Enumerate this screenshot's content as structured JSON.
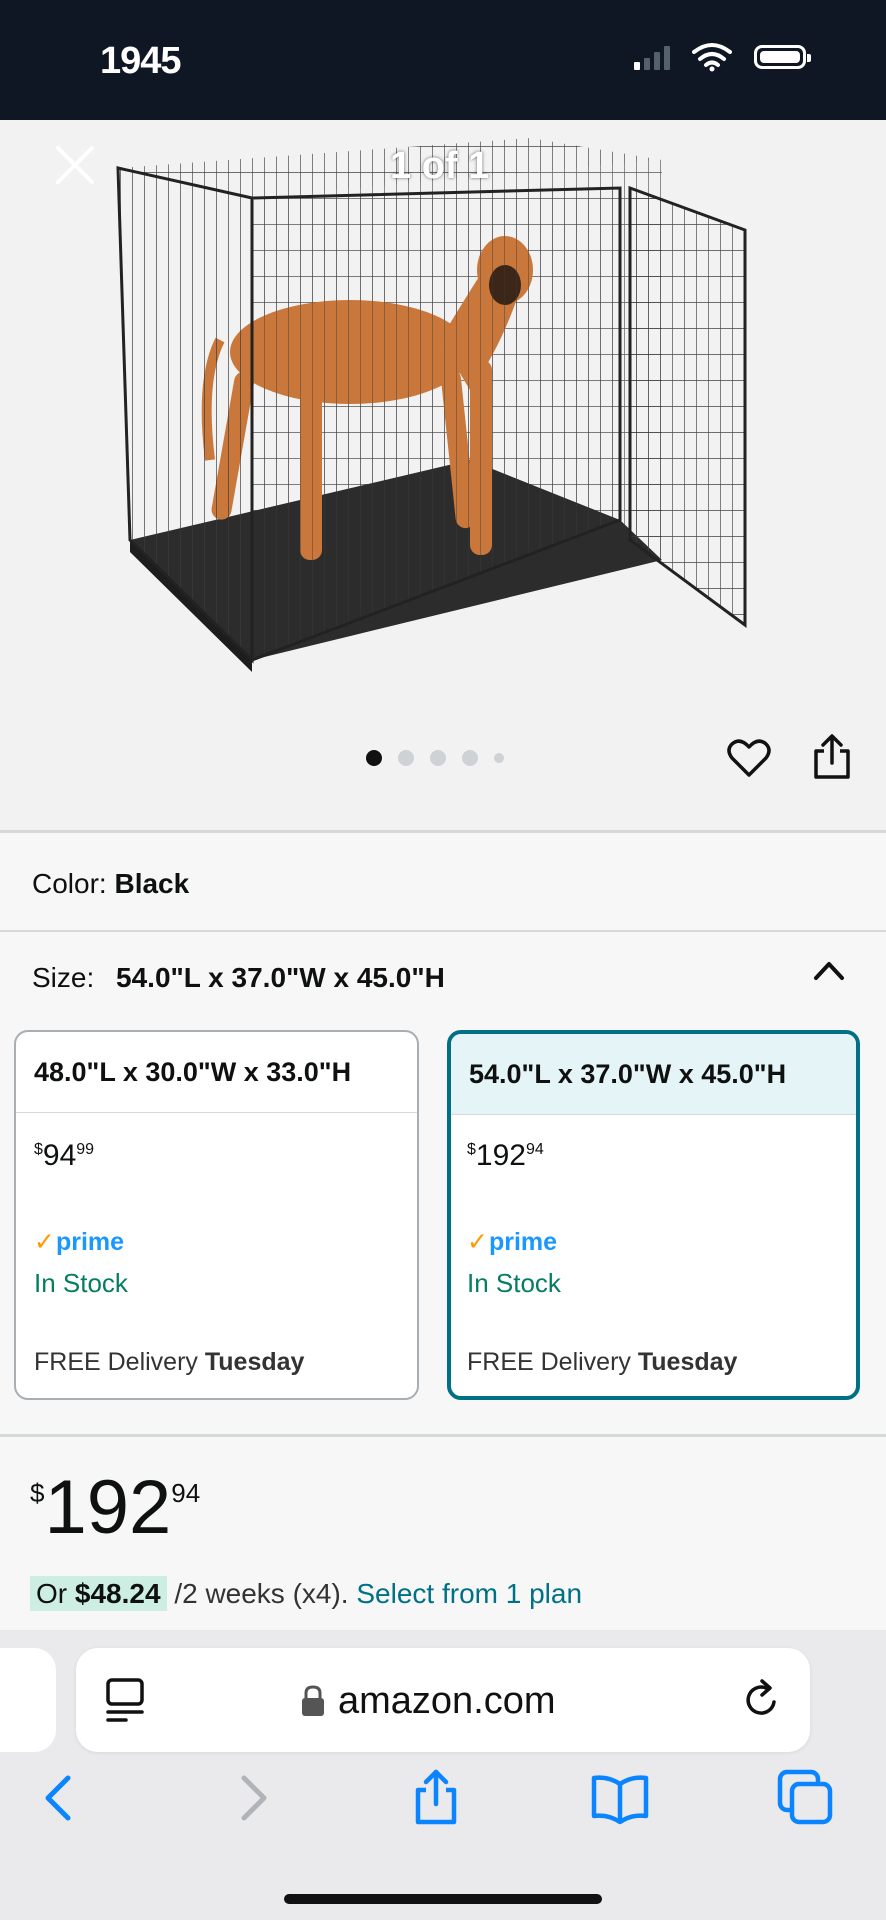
{
  "status": {
    "time": "1945"
  },
  "gallery": {
    "counter": "1 of 1",
    "image": "black wire dog crate with great dane"
  },
  "color": {
    "label": "Color:",
    "value": "Black"
  },
  "size": {
    "label": "Size:",
    "value": "54.0\"L x 37.0\"W x 45.0\"H"
  },
  "options": [
    {
      "size": "48.0\"L x 30.0\"W x 33.0\"H",
      "price_symbol": "$",
      "price_whole": "94",
      "price_fraction": "99",
      "prime": "prime",
      "stock": "In Stock",
      "delivery_prefix": "FREE Delivery",
      "delivery_day": "Tuesday"
    },
    {
      "size": "54.0\"L x 37.0\"W x 45.0\"H",
      "price_symbol": "$",
      "price_whole": "192",
      "price_fraction": "94",
      "prime": "prime",
      "stock": "In Stock",
      "delivery_prefix": "FREE Delivery",
      "delivery_day": "Tuesday"
    }
  ],
  "price": {
    "symbol": "$",
    "whole": "192",
    "fraction": "94"
  },
  "installment": {
    "prefix": "Or",
    "amount": "$48.24",
    "terms": "/2 weeks (x4).",
    "link": "Select from 1 plan"
  },
  "browser": {
    "url": "amazon.com"
  },
  "colors": {
    "accent": "#007185",
    "prime": "#1a98ff",
    "stock": "#067d62",
    "ios_blue": "#0a84ff"
  }
}
